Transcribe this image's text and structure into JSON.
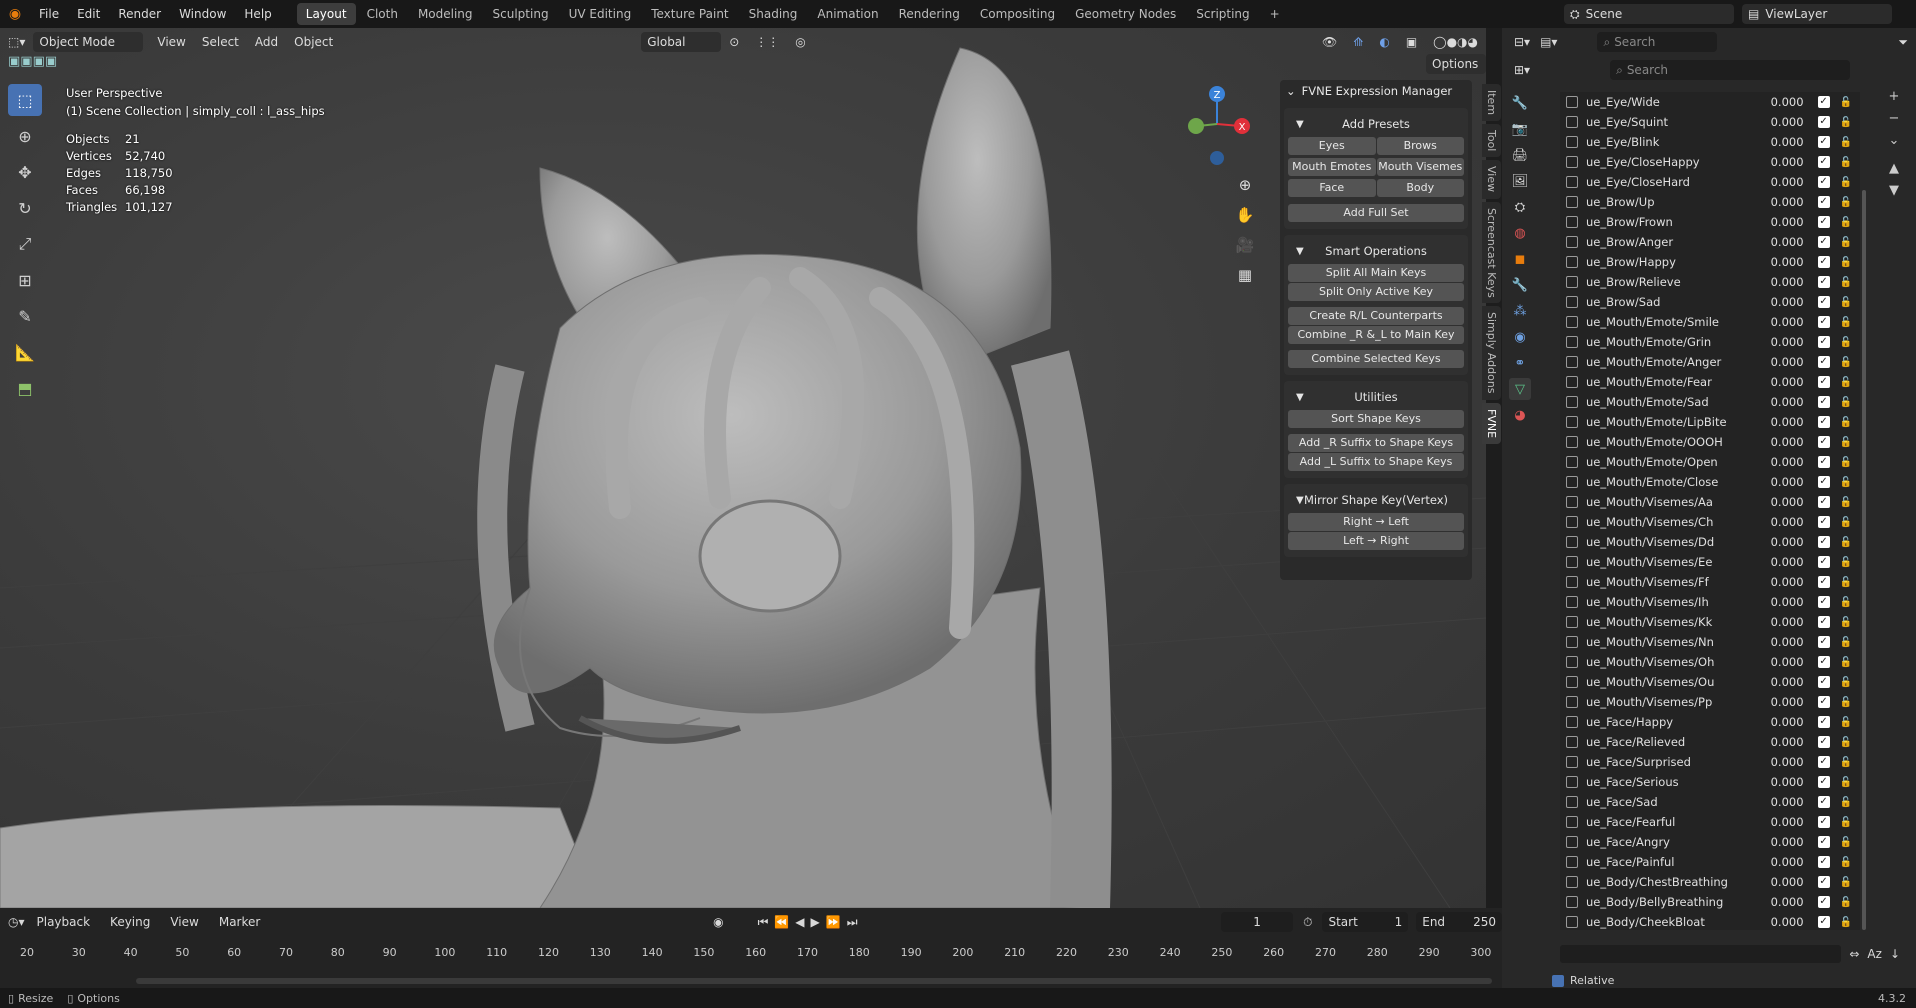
{
  "menubar": {
    "items": [
      "File",
      "Edit",
      "Render",
      "Window",
      "Help"
    ],
    "workspaces": [
      "Layout",
      "Cloth",
      "Modeling",
      "Sculpting",
      "UV Editing",
      "Texture Paint",
      "Shading",
      "Animation",
      "Rendering",
      "Compositing",
      "Geometry Nodes",
      "Scripting"
    ],
    "scene": "Scene",
    "view_layer": "ViewLayer"
  },
  "viewport_header": {
    "mode": "Object Mode",
    "menus": [
      "View",
      "Select",
      "Add",
      "Object"
    ],
    "transform": "Global",
    "options": "Options"
  },
  "overlay": {
    "perspective": "User Perspective",
    "collection": "(1) Scene Collection | simply_coll : l_ass_hips",
    "stats": [
      {
        "label": "Objects",
        "value": "21"
      },
      {
        "label": "Vertices",
        "value": "52,740"
      },
      {
        "label": "Edges",
        "value": "118,750"
      },
      {
        "label": "Faces",
        "value": "66,198"
      },
      {
        "label": "Triangles",
        "value": "101,127"
      }
    ]
  },
  "gizmo": {
    "z": "Z",
    "x": "X"
  },
  "fvne": {
    "title": "FVNE Expression Manager",
    "add_presets": {
      "title": "Add Presets",
      "buttons": [
        "Eyes",
        "Brows",
        "Mouth Emotes",
        "Mouth Visemes",
        "Face",
        "Body"
      ],
      "full": "Add Full Set"
    },
    "smart": {
      "title": "Smart Operations",
      "buttons": [
        "Split All Main Keys",
        "Split Only Active Key",
        "Create R/L Counterparts",
        "Combine _R &_L to Main Key",
        "Combine Selected Keys"
      ]
    },
    "utilities": {
      "title": "Utilities",
      "buttons": [
        "Sort Shape Keys",
        "Add _R Suffix to Shape Keys",
        "Add _L Suffix to Shape Keys"
      ]
    },
    "mirror": {
      "title": "Mirror Shape Key(Vertex)",
      "buttons": [
        "Right → Left",
        "Left → Right"
      ]
    }
  },
  "side_tabs": [
    "Item",
    "Tool",
    "View",
    "Screencast Keys",
    "Simply Addons",
    "FVNE"
  ],
  "properties": {
    "search_placeholder": "Search",
    "shape_keys": [
      {
        "name": "ue_Eye/Wide",
        "value": "0.000"
      },
      {
        "name": "ue_Eye/Squint",
        "value": "0.000"
      },
      {
        "name": "ue_Eye/Blink",
        "value": "0.000"
      },
      {
        "name": "ue_Eye/CloseHappy",
        "value": "0.000"
      },
      {
        "name": "ue_Eye/CloseHard",
        "value": "0.000"
      },
      {
        "name": "ue_Brow/Up",
        "value": "0.000"
      },
      {
        "name": "ue_Brow/Frown",
        "value": "0.000"
      },
      {
        "name": "ue_Brow/Anger",
        "value": "0.000"
      },
      {
        "name": "ue_Brow/Happy",
        "value": "0.000"
      },
      {
        "name": "ue_Brow/Relieve",
        "value": "0.000"
      },
      {
        "name": "ue_Brow/Sad",
        "value": "0.000"
      },
      {
        "name": "ue_Mouth/Emote/Smile",
        "value": "0.000"
      },
      {
        "name": "ue_Mouth/Emote/Grin",
        "value": "0.000"
      },
      {
        "name": "ue_Mouth/Emote/Anger",
        "value": "0.000"
      },
      {
        "name": "ue_Mouth/Emote/Fear",
        "value": "0.000"
      },
      {
        "name": "ue_Mouth/Emote/Sad",
        "value": "0.000"
      },
      {
        "name": "ue_Mouth/Emote/LipBite",
        "value": "0.000"
      },
      {
        "name": "ue_Mouth/Emote/OOOH",
        "value": "0.000"
      },
      {
        "name": "ue_Mouth/Emote/Open",
        "value": "0.000"
      },
      {
        "name": "ue_Mouth/Emote/Close",
        "value": "0.000"
      },
      {
        "name": "ue_Mouth/Visemes/Aa",
        "value": "0.000"
      },
      {
        "name": "ue_Mouth/Visemes/Ch",
        "value": "0.000"
      },
      {
        "name": "ue_Mouth/Visemes/Dd",
        "value": "0.000"
      },
      {
        "name": "ue_Mouth/Visemes/Ee",
        "value": "0.000"
      },
      {
        "name": "ue_Mouth/Visemes/Ff",
        "value": "0.000"
      },
      {
        "name": "ue_Mouth/Visemes/Ih",
        "value": "0.000"
      },
      {
        "name": "ue_Mouth/Visemes/Kk",
        "value": "0.000"
      },
      {
        "name": "ue_Mouth/Visemes/Nn",
        "value": "0.000"
      },
      {
        "name": "ue_Mouth/Visemes/Oh",
        "value": "0.000"
      },
      {
        "name": "ue_Mouth/Visemes/Ou",
        "value": "0.000"
      },
      {
        "name": "ue_Mouth/Visemes/Pp",
        "value": "0.000"
      },
      {
        "name": "ue_Face/Happy",
        "value": "0.000"
      },
      {
        "name": "ue_Face/Relieved",
        "value": "0.000"
      },
      {
        "name": "ue_Face/Surprised",
        "value": "0.000"
      },
      {
        "name": "ue_Face/Serious",
        "value": "0.000"
      },
      {
        "name": "ue_Face/Sad",
        "value": "0.000"
      },
      {
        "name": "ue_Face/Fearful",
        "value": "0.000"
      },
      {
        "name": "ue_Face/Angry",
        "value": "0.000"
      },
      {
        "name": "ue_Face/Painful",
        "value": "0.000"
      },
      {
        "name": "ue_Body/ChestBreathing",
        "value": "0.000"
      },
      {
        "name": "ue_Body/BellyBreathing",
        "value": "0.000"
      },
      {
        "name": "ue_Body/CheekBloat",
        "value": "0.000"
      }
    ],
    "relative": "Relative"
  },
  "timeline": {
    "menus": [
      "Playback",
      "Keying",
      "View",
      "Marker"
    ],
    "current_frame": "1",
    "start_label": "Start",
    "start": "1",
    "end_label": "End",
    "end": "250",
    "ticks": [
      "20",
      "30",
      "40",
      "50",
      "60",
      "70",
      "80",
      "90",
      "100",
      "110",
      "120",
      "130",
      "140",
      "150",
      "160",
      "170",
      "180",
      "190",
      "200",
      "210",
      "220",
      "230",
      "240",
      "250",
      "260",
      "270",
      "280",
      "290",
      "300"
    ]
  },
  "statusbar": {
    "resize": "Resize",
    "options": "Options",
    "version": "4.3.2"
  },
  "colors": {
    "accent": "#4772b3",
    "x_axis": "#e0303a",
    "y_axis": "#6ea64a",
    "z_axis": "#3b83d9"
  }
}
